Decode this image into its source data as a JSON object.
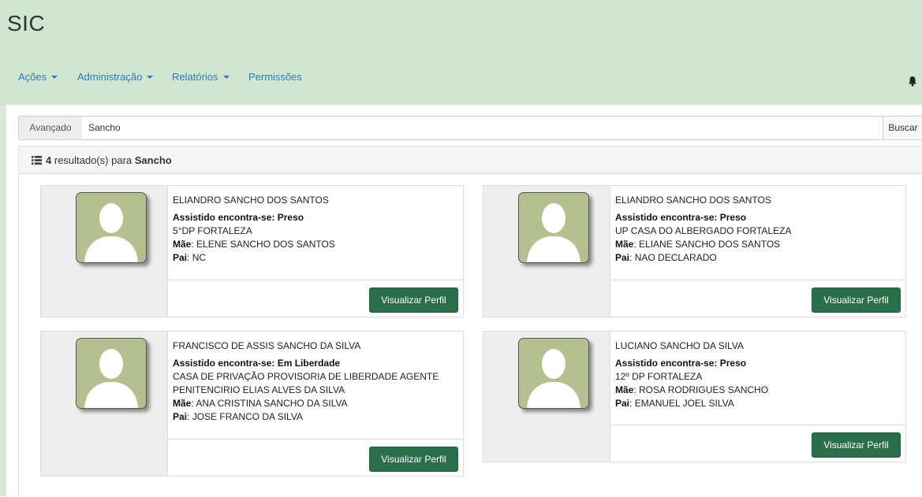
{
  "app": {
    "title": "SIC"
  },
  "nav": [
    {
      "label": "Ações",
      "dropdown": true
    },
    {
      "label": "Administração",
      "dropdown": true
    },
    {
      "label": "Relatórios",
      "dropdown": true
    },
    {
      "label": "Permissões",
      "dropdown": false
    }
  ],
  "icons": {
    "notifications": "bell-icon",
    "results": "list-icon",
    "avatar": "person-silhouette-icon"
  },
  "search": {
    "mode_label": "Avançado",
    "value": "Sancho",
    "button_label": "Buscar"
  },
  "results": {
    "count": "4",
    "label": "resultado(s) para",
    "query": "Sancho"
  },
  "labels": {
    "status": "Assistido encontra-se:",
    "mother": "Mãe",
    "father": "Pai",
    "view_profile": "Visualizar Perfil"
  },
  "cards": [
    {
      "name": "ELIANDRO SANCHO DOS SANTOS",
      "status": "Preso",
      "location": "5°DP FORTALEZA",
      "mother": "ELENE SANCHO DOS SANTOS",
      "father": "NC"
    },
    {
      "name": "ELIANDRO SANCHO DOS SANTOS",
      "status": "Preso",
      "location": "UP CASA DO ALBERGADO FORTALEZA",
      "mother": "ELIANE SANCHO DOS SANTOS",
      "father": "NAO DECLARADO"
    },
    {
      "name": "FRANCISCO DE ASSIS SANCHO DA SILVA",
      "status": "Em Liberdade",
      "location": "CASA DE PRIVAÇÃO PROVISORIA DE LIBERDADE AGENTE PENITENCIRIO ELIAS ALVES DA SILVA",
      "mother": "ANA CRISTINA SANCHO DA SILVA",
      "father": "JOSE FRANCO DA SILVA"
    },
    {
      "name": "LUCIANO SANCHO DA SILVA",
      "status": "Preso",
      "location": "12º DP FORTALEZA",
      "mother": "ROSA RODRIGUES SANCHO",
      "father": "EMANUEL JOEL SILVA"
    }
  ],
  "colors": {
    "header_bg": "#cfe6cf",
    "link": "#337ab7",
    "button_green": "#2a6e4a",
    "avatar_bg": "#b6bf8e"
  }
}
